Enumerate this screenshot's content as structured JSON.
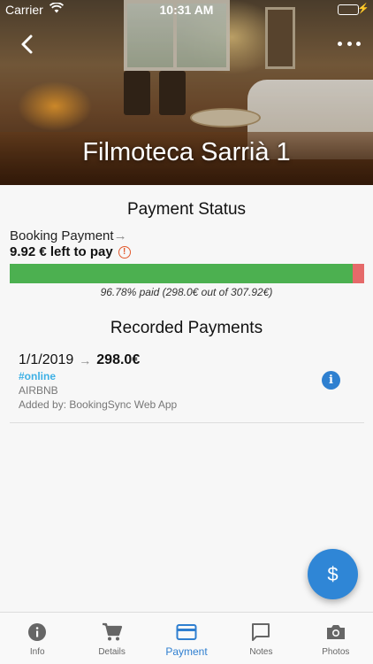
{
  "status_bar": {
    "carrier": "Carrier",
    "time": "10:31 AM"
  },
  "header": {
    "title": "Filmoteca Sarrià 1"
  },
  "payment_status": {
    "title": "Payment Status",
    "booking_link": "Booking Payment",
    "left_to_pay": "9.92 € left to pay",
    "paid_fraction": 0.9678,
    "progress_text": "96.78% paid (298.0€ out of 307.92€)"
  },
  "recorded_payments": {
    "title": "Recorded Payments",
    "items": [
      {
        "date": "1/1/2019",
        "amount": "298.0€",
        "tag": "#online",
        "source": "AIRBNB",
        "added_by": "Added by: BookingSync Web App"
      }
    ]
  },
  "tabs": [
    {
      "label": "Info",
      "icon": "info-icon"
    },
    {
      "label": "Details",
      "icon": "cart-icon"
    },
    {
      "label": "Payment",
      "icon": "credit-card-icon",
      "active": true
    },
    {
      "label": "Notes",
      "icon": "chat-icon"
    },
    {
      "label": "Photos",
      "icon": "camera-icon"
    }
  ],
  "colors": {
    "paid": "#4cb050",
    "unpaid": "#e56a6a",
    "accent": "#2f7fd0",
    "tag": "#3db0e5"
  }
}
